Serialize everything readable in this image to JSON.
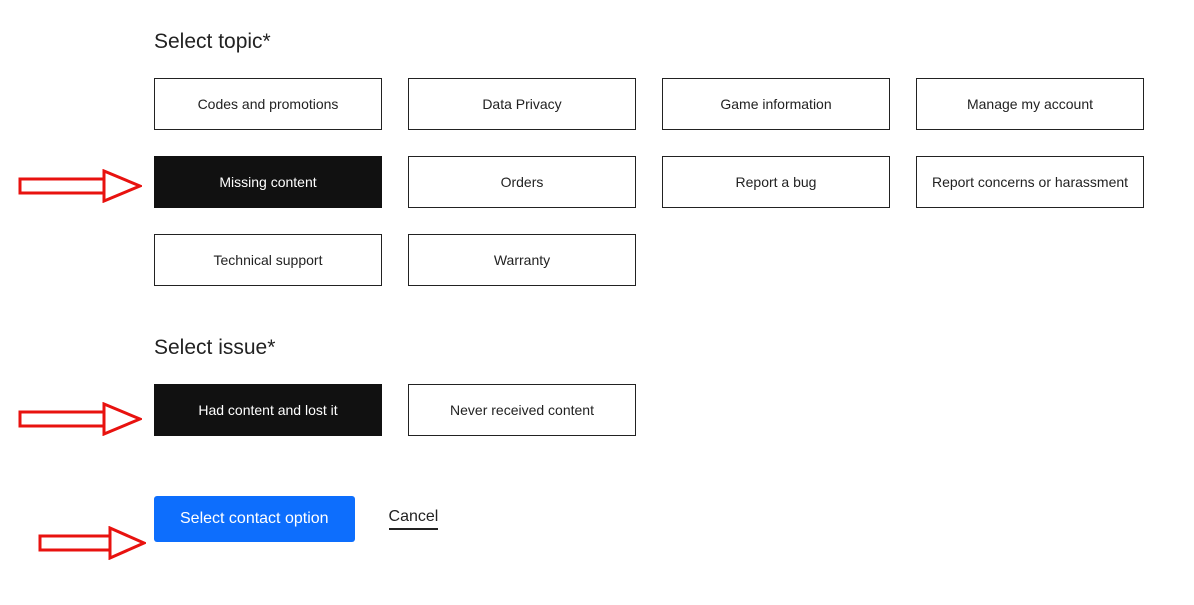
{
  "section1": {
    "title": "Select topic*"
  },
  "section2": {
    "title": "Select issue*"
  },
  "topics": [
    {
      "label": "Codes and promotions",
      "selected": false
    },
    {
      "label": "Data Privacy",
      "selected": false
    },
    {
      "label": "Game information",
      "selected": false
    },
    {
      "label": "Manage my account",
      "selected": false
    },
    {
      "label": "Missing content",
      "selected": true
    },
    {
      "label": "Orders",
      "selected": false
    },
    {
      "label": "Report a bug",
      "selected": false
    },
    {
      "label": "Report concerns or harassment",
      "selected": false
    },
    {
      "label": "Technical support",
      "selected": false
    },
    {
      "label": "Warranty",
      "selected": false
    }
  ],
  "issues": [
    {
      "label": "Had content and lost it",
      "selected": true
    },
    {
      "label": "Never received content",
      "selected": false
    }
  ],
  "actions": {
    "primary": "Select contact option",
    "cancel": "Cancel"
  },
  "annotations": {
    "arrow_color": "#e8120f"
  }
}
